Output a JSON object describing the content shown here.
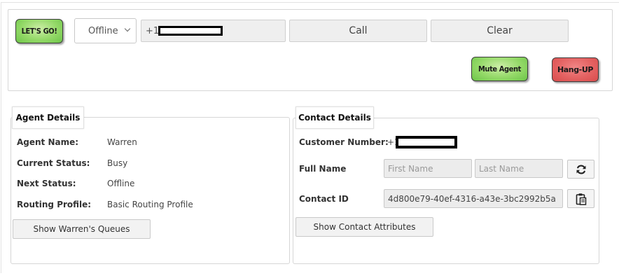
{
  "toolbar": {
    "go_label": "LET'S GO!",
    "status_select_value": "Offline",
    "phone_prefix": "+1",
    "call_label": "Call",
    "clear_label": "Clear",
    "mute_label": "Mute Agent",
    "hangup_label": "Hang-UP"
  },
  "agent_details": {
    "title": "Agent Details",
    "rows": [
      {
        "label": "Agent Name:",
        "value": "Warren"
      },
      {
        "label": "Current Status:",
        "value": "Busy"
      },
      {
        "label": "Next Status:",
        "value": "Offline"
      },
      {
        "label": "Routing Profile:",
        "value": "Basic Routing Profile"
      }
    ],
    "queues_button": "Show Warren's Queues"
  },
  "contact_details": {
    "title": "Contact Details",
    "customer_number_label": "Customer Number:",
    "customer_number_prefix": "+1",
    "full_name_label": "Full Name",
    "first_name_placeholder": "First Name",
    "last_name_placeholder": "Last Name",
    "contact_id_label": "Contact ID",
    "contact_id_value": "4d800e79-40ef-4316-a43e-3bc2992b5a",
    "attributes_button": "Show Contact Attributes"
  },
  "icons": {
    "refresh": "refresh-icon",
    "clipboard": "clipboard-icon",
    "dropdown": "chevron-down-icon"
  },
  "colors": {
    "go_green": "#94d968",
    "hangup_red": "#e46262"
  }
}
